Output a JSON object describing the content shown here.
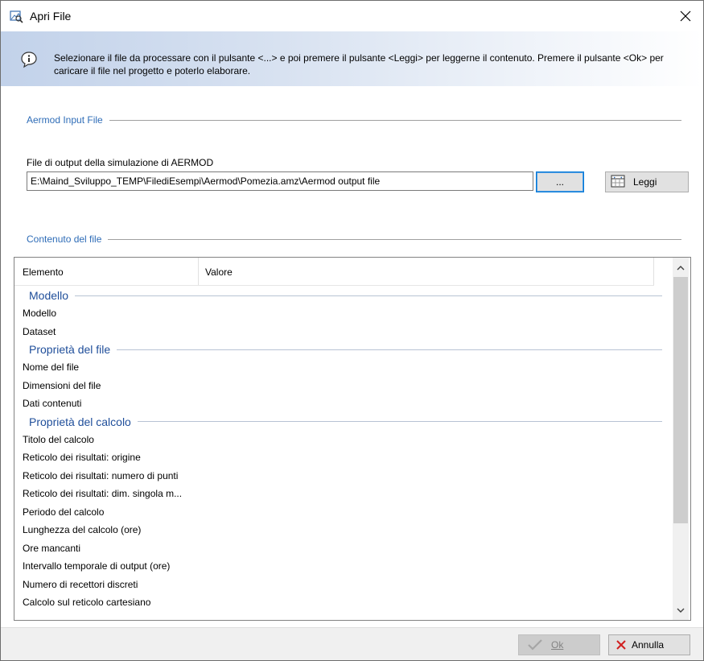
{
  "window": {
    "title": "Apri File"
  },
  "banner": {
    "text": "Selezionare il file da processare con il pulsante <...> e poi premere il pulsante <Leggi> per leggerne il contenuto. Premere il pulsante <Ok> per caricare il file nel progetto e poterlo elaborare."
  },
  "input_group": {
    "title": "Aermod Input File",
    "field_label": "File di output della simulazione di AERMOD",
    "path_value": "E:\\Maind_Sviluppo_TEMP\\FilediEsempi\\Aermod\\Pomezia.amz\\Aermod output file",
    "browse_label": "...",
    "read_label": "Leggi"
  },
  "content_group": {
    "title": "Contenuto del file"
  },
  "grid": {
    "columns": [
      "Elemento",
      "Valore"
    ],
    "categories": [
      {
        "name": "Modello",
        "rows": [
          "Modello",
          "Dataset"
        ]
      },
      {
        "name": "Proprietà del file",
        "rows": [
          "Nome del file",
          "Dimensioni del file",
          "Dati contenuti"
        ]
      },
      {
        "name": "Proprietà del calcolo",
        "rows": [
          "Titolo del calcolo",
          "Reticolo dei risultati: origine",
          "Reticolo dei risultati: numero di punti",
          "Reticolo dei risultati: dim. singola m...",
          "Periodo del calcolo",
          "Lunghezza del calcolo (ore)",
          "Ore mancanti",
          "Intervallo temporale di output (ore)",
          "Numero di recettori discreti",
          "Calcolo sul reticolo cartesiano"
        ]
      }
    ]
  },
  "footer": {
    "ok_label": "Ok",
    "cancel_label": "Annulla"
  },
  "colors": {
    "accent": "#2e6cb7",
    "category": "#1f4e9a",
    "banner": "#c2d2ea"
  }
}
